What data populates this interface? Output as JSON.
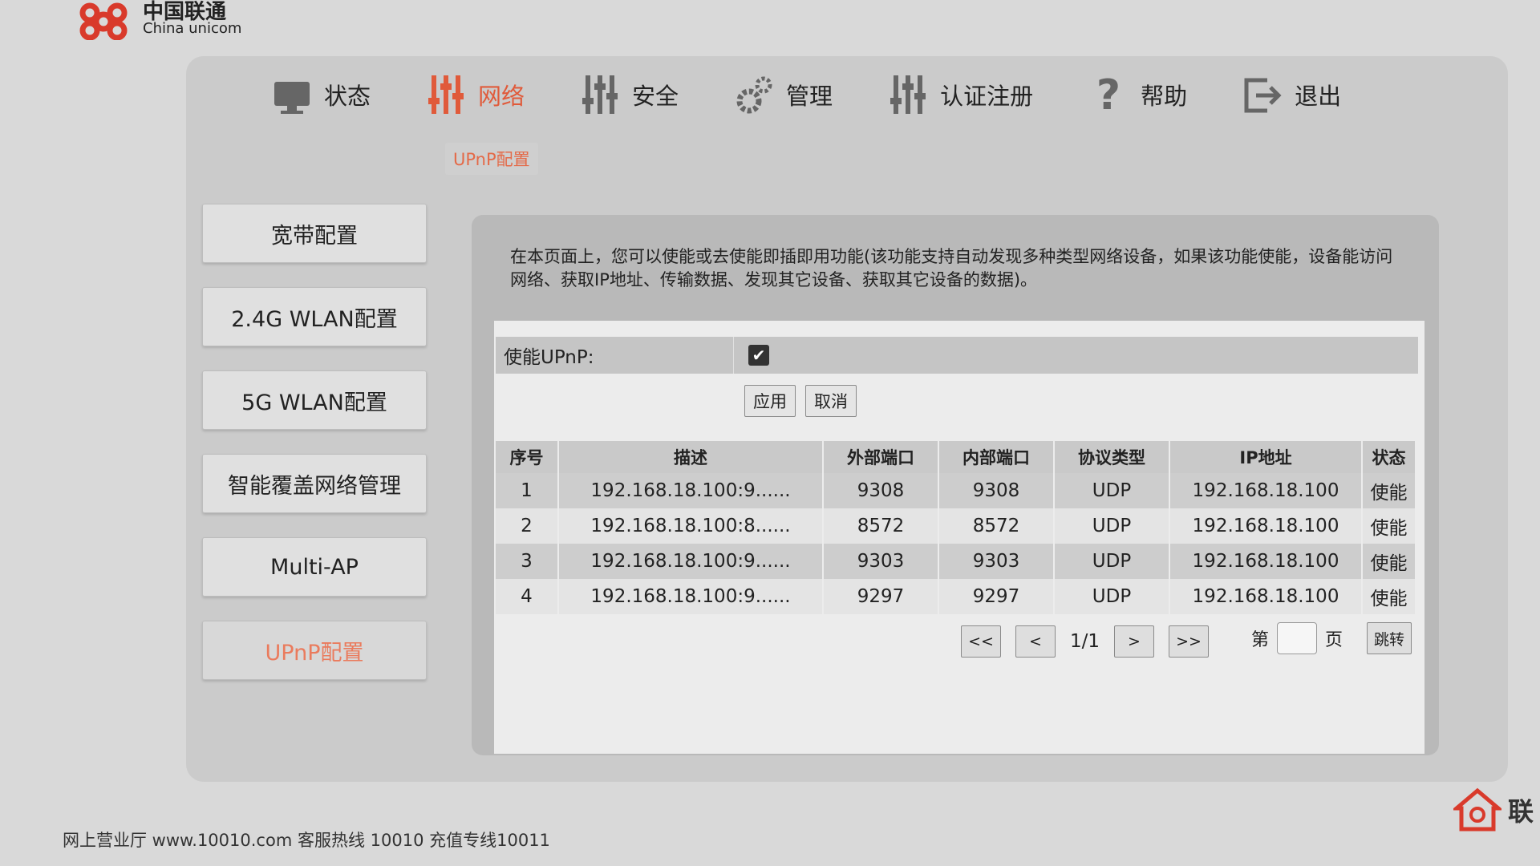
{
  "brand": {
    "name_cn": "中国联通",
    "name_en": "China unicom",
    "accent": "#d93a2b"
  },
  "nav": [
    {
      "label": "状态",
      "icon": "monitor-icon",
      "active": false
    },
    {
      "label": "网络",
      "icon": "sliders-icon",
      "active": true
    },
    {
      "label": "安全",
      "icon": "sliders-icon",
      "active": false
    },
    {
      "label": "管理",
      "icon": "gear-icon",
      "active": false
    },
    {
      "label": "认证注册",
      "icon": "sliders-icon",
      "active": false
    },
    {
      "label": "帮助",
      "icon": "question-icon",
      "active": false
    },
    {
      "label": "退出",
      "icon": "logout-icon",
      "active": false
    }
  ],
  "subtab": "UPnP配置",
  "sidemenu": [
    {
      "label": "宽带配置",
      "active": false
    },
    {
      "label": "2.4G WLAN配置",
      "active": false
    },
    {
      "label": "5G WLAN配置",
      "active": false
    },
    {
      "label": "智能覆盖网络管理",
      "active": false
    },
    {
      "label": "Multi-AP",
      "active": false
    },
    {
      "label": "UPnP配置",
      "active": true
    }
  ],
  "description": "在本页面上，您可以使能或去使能即插即用功能(该功能支持自动发现多种类型网络设备，如果该功能使能，设备能访问网络、获取IP地址、传输数据、发现其它设备、获取其它设备的数据)。",
  "upnp": {
    "label": "使能UPnP:",
    "enabled": true,
    "check_mark": "✔"
  },
  "buttons": {
    "apply": "应用",
    "cancel": "取消"
  },
  "table": {
    "headers": [
      "序号",
      "描述",
      "外部端口",
      "内部端口",
      "协议类型",
      "IP地址",
      "状态"
    ],
    "rows": [
      [
        "1",
        "192.168.18.100:9......",
        "9308",
        "9308",
        "UDP",
        "192.168.18.100",
        "使能"
      ],
      [
        "2",
        "192.168.18.100:8......",
        "8572",
        "8572",
        "UDP",
        "192.168.18.100",
        "使能"
      ],
      [
        "3",
        "192.168.18.100:9......",
        "9303",
        "9303",
        "UDP",
        "192.168.18.100",
        "使能"
      ],
      [
        "4",
        "192.168.18.100:9......",
        "9297",
        "9297",
        "UDP",
        "192.168.18.100",
        "使能"
      ]
    ]
  },
  "pager": {
    "first": "<<",
    "prev": "<",
    "page": "1/1",
    "next": ">",
    "last": ">>",
    "goto_prefix": "第",
    "goto_suffix": "页",
    "goto_button": "跳转",
    "goto_value": ""
  },
  "footer": "网上营业厅 www.10010.com 客服热线 10010 充值专线10011",
  "corner": "联"
}
